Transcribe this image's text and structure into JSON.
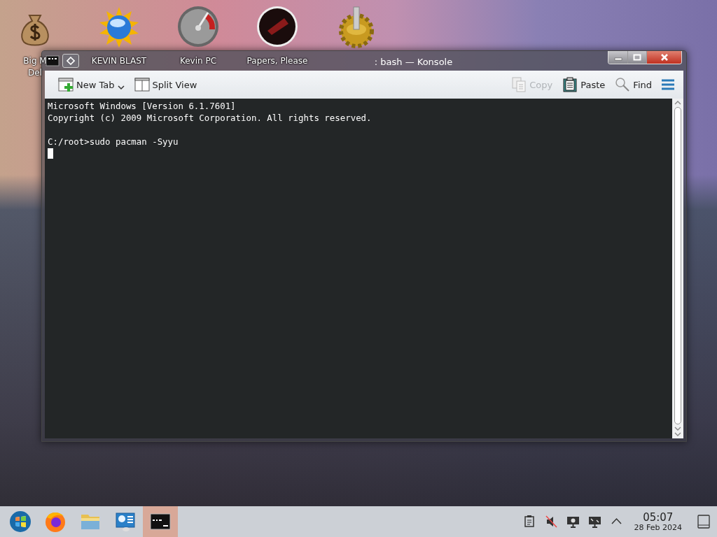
{
  "desktop_icons": [
    {
      "kind": "money-bag",
      "label_lines": [
        "Big M",
        "Del"
      ]
    },
    {
      "kind": "sun-globe",
      "label_lines": [
        "KEVIN BLAST"
      ]
    },
    {
      "kind": "gauge",
      "label_lines": [
        "Kevin PC"
      ]
    },
    {
      "kind": "red-disc",
      "label_lines": [
        "Papers, Please"
      ]
    },
    {
      "kind": "gear"
    }
  ],
  "window": {
    "title": ": bash — Konsole",
    "toolbar": [
      {
        "kind": "new-tab",
        "label": "New Tab",
        "disabled": false,
        "dropdown": true
      },
      {
        "kind": "split",
        "label": "Split View",
        "disabled": false,
        "dropdown": false
      },
      {
        "kind": "copy",
        "label": "Copy",
        "disabled": true,
        "dropdown": false
      },
      {
        "kind": "paste",
        "label": "Paste",
        "disabled": false,
        "dropdown": false
      },
      {
        "kind": "find",
        "label": "Find",
        "disabled": false,
        "dropdown": false
      }
    ],
    "terminal_blocks": [
      [
        "Microsoft Windows [Version 6.1.7601]",
        "Copyright (c) 2009 Microsoft Corporation. All rights reserved."
      ],
      [
        "C:/root>sudo pacman -Syyu"
      ]
    ]
  },
  "taskbar": {
    "items": [
      {
        "kind": "start",
        "selected": false
      },
      {
        "kind": "browser",
        "selected": false
      },
      {
        "kind": "folder",
        "selected": false
      },
      {
        "kind": "control",
        "selected": false
      },
      {
        "kind": "terminal",
        "selected": true
      }
    ],
    "tray": [
      {
        "kind": "clipboard"
      },
      {
        "kind": "muted"
      },
      {
        "kind": "monitor"
      },
      {
        "kind": "display"
      },
      {
        "kind": "caret"
      }
    ],
    "time": "05:07",
    "date": "28 Feb 2024"
  }
}
